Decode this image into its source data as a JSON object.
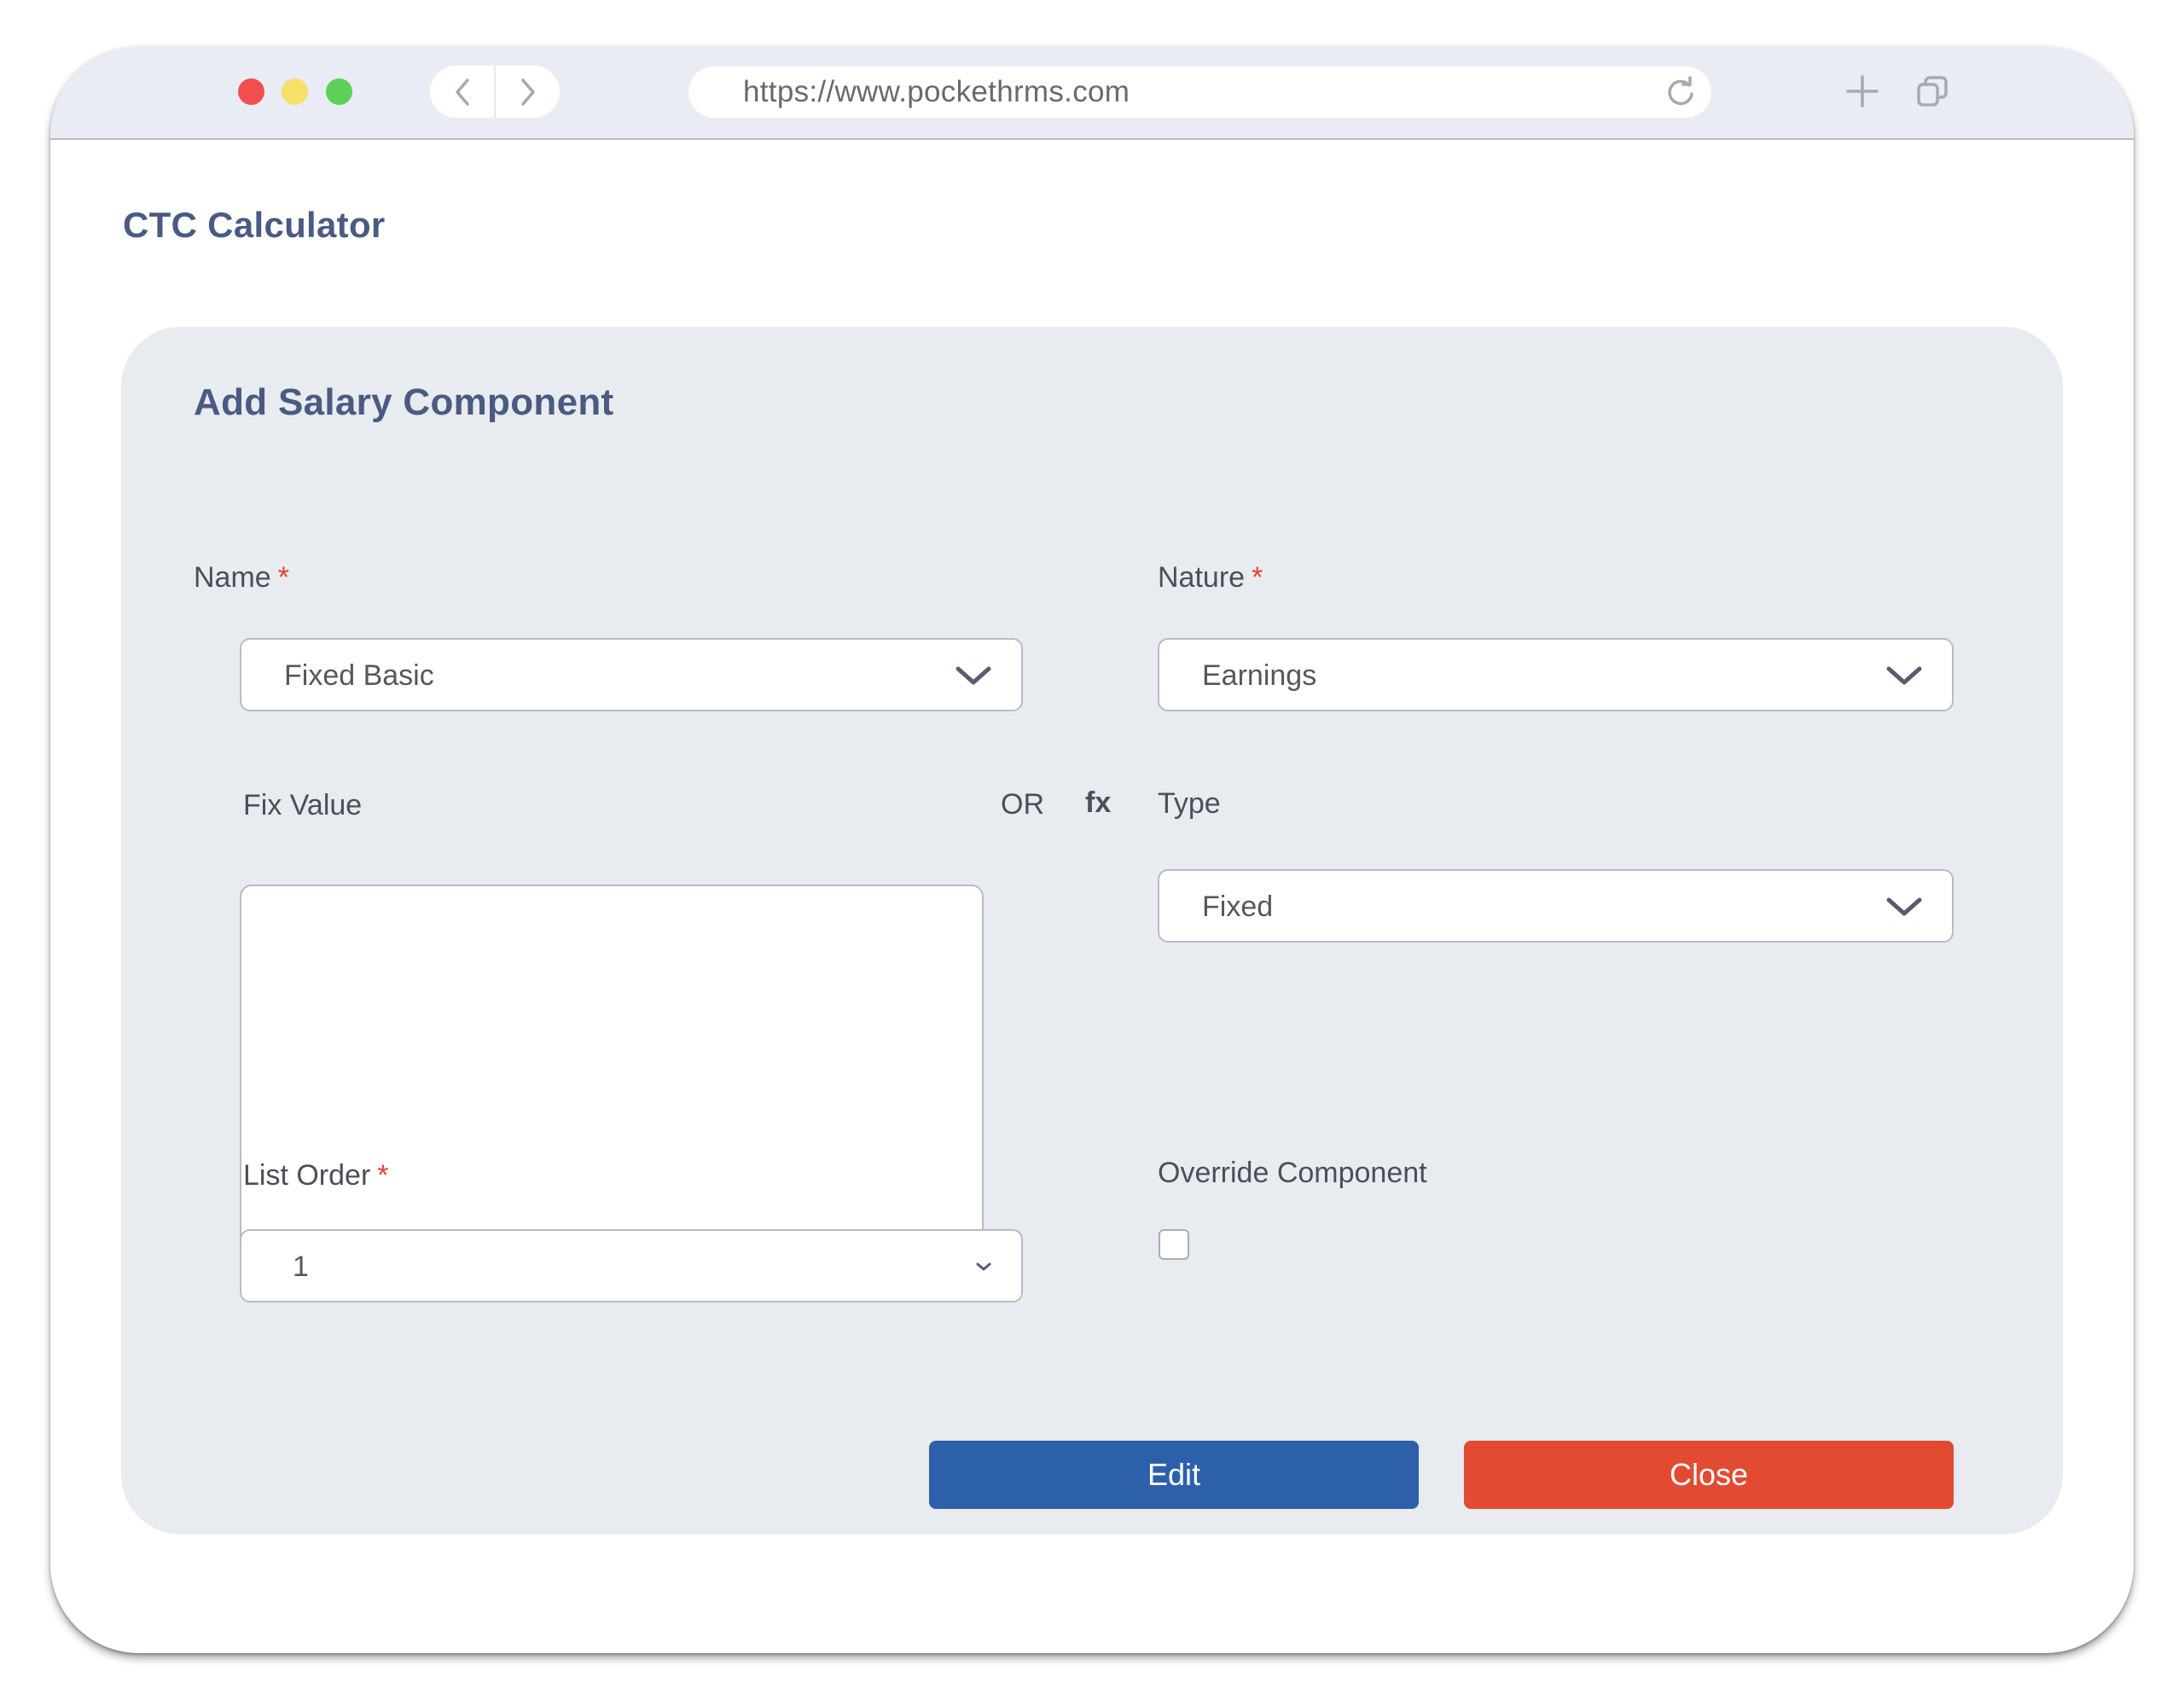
{
  "browser": {
    "url": "https://www.pockethrms.com",
    "icons": {
      "traffic_lights": [
        "close-dot",
        "minimize-dot",
        "maximize-dot"
      ],
      "back": "chevron-left-icon",
      "forward": "chevron-right-icon",
      "reload": "reload-icon",
      "new_tab": "plus-icon",
      "tabs": "tabs-icon"
    },
    "colors": {
      "close": "#f24e4e",
      "minimize": "#f7df68",
      "maximize": "#5dd05a"
    }
  },
  "page": {
    "title": "CTC Calculator"
  },
  "form": {
    "title": "Add Salary Component",
    "required_marker": "*",
    "name": {
      "label": "Name",
      "value": "Fixed Basic",
      "required": true
    },
    "nature": {
      "label": "Nature",
      "value": "Earnings",
      "required": true
    },
    "fix_value": {
      "label": "Fix Value",
      "value": ""
    },
    "or_label": "OR",
    "formula_label": "fx",
    "type": {
      "label": "Type",
      "value": "Fixed"
    },
    "list_order": {
      "label": "List Order",
      "value": "1",
      "required": true
    },
    "override_component": {
      "label": "Override Component",
      "checked": false
    },
    "buttons": {
      "edit": "Edit",
      "close": "Close"
    },
    "colors": {
      "edit": "#2d60ab",
      "close": "#e24a32",
      "required": "#e2432f",
      "heading": "#4a5b82"
    }
  }
}
